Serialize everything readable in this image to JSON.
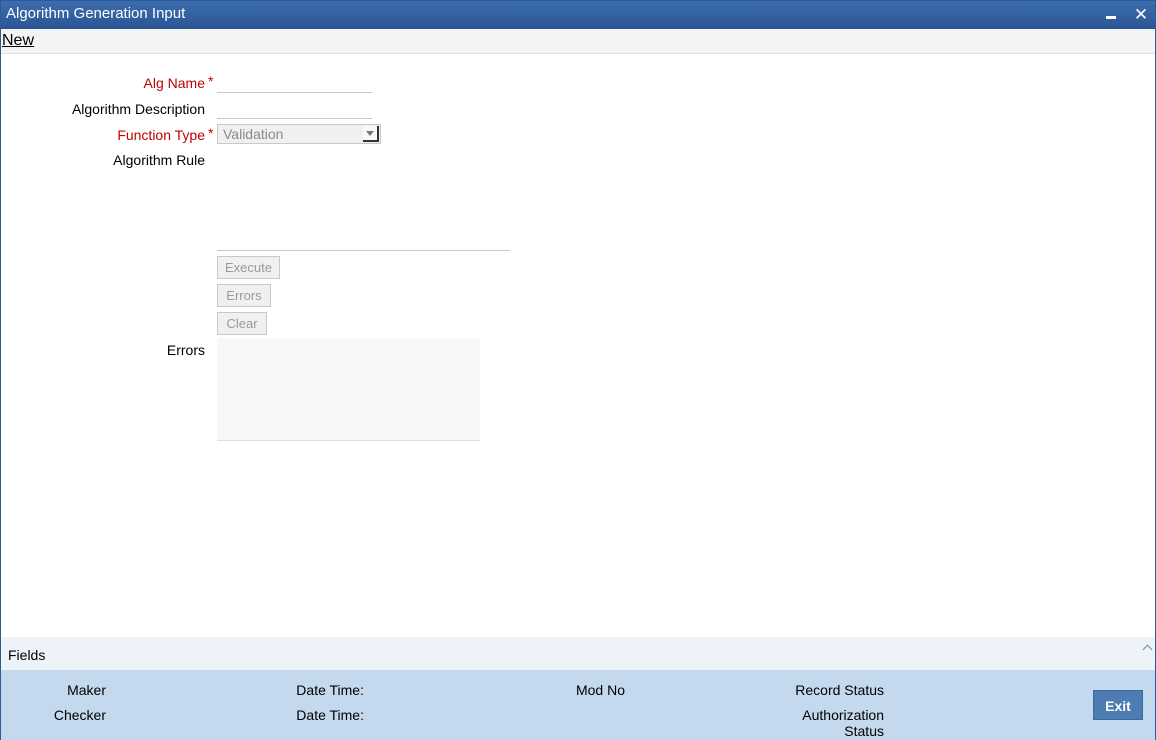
{
  "window": {
    "title": "Algorithm Generation Input",
    "close_glyph": "✕"
  },
  "toolbar": {
    "new_label": "New"
  },
  "form": {
    "alg_name_label": "Alg Name",
    "alg_name_value": "",
    "algorithm_description_label": "Algorithm Description",
    "algorithm_description_value": "",
    "function_type_label": "Function Type",
    "function_type_value": "Validation",
    "algorithm_rule_label": "Algorithm Rule",
    "algorithm_rule_value": "",
    "required_marker": "*",
    "execute_label": "Execute",
    "errors_button_label": "Errors",
    "clear_label": "Clear",
    "errors_label": "Errors"
  },
  "fields_bar": {
    "label": "Fields"
  },
  "footer": {
    "maker_label": "Maker",
    "checker_label": "Checker",
    "date_time_label": "Date Time:",
    "mod_no_label": "Mod No",
    "record_status_label": "Record Status",
    "authorization_label": "Authorization",
    "status_label": "Status",
    "exit_label": "Exit"
  },
  "colors": {
    "title_bar": "#2a5595",
    "required_label": "#c00000",
    "footer_bg": "#c4d8ee",
    "exit_button": "#4d7cb2"
  },
  "icons": {
    "minimize": "minimize-icon",
    "close": "close-icon",
    "dropdown": "chevron-down-icon",
    "expand": "chevron-up-icon"
  }
}
